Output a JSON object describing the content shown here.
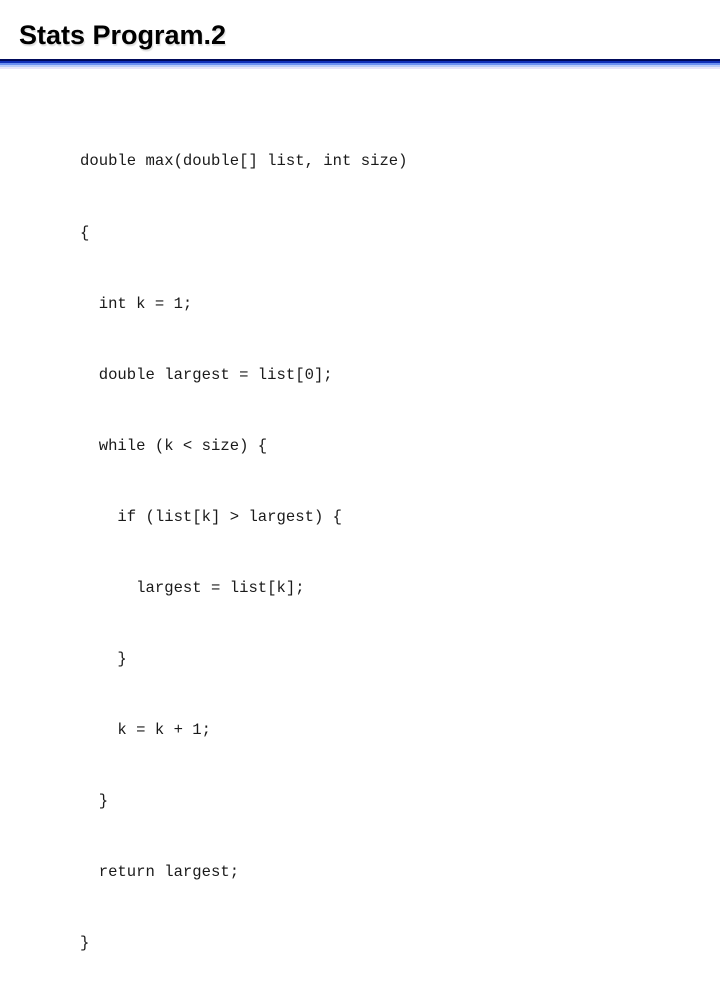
{
  "slide": {
    "title": "Stats Program.2",
    "code_lines": [
      "double max(double[] list, int size)",
      "{",
      "  int k = 1;",
      "  double largest = list[0];",
      "  while (k < size) {",
      "    if (list[k] > largest) {",
      "      largest = list[k];",
      "    }",
      "    k = k + 1;",
      "  }",
      "  return largest;",
      "}"
    ]
  },
  "colors": {
    "rule_dark": "#000a5a",
    "rule_mid": "#1030b8",
    "rule_light": "#6a90f0"
  }
}
